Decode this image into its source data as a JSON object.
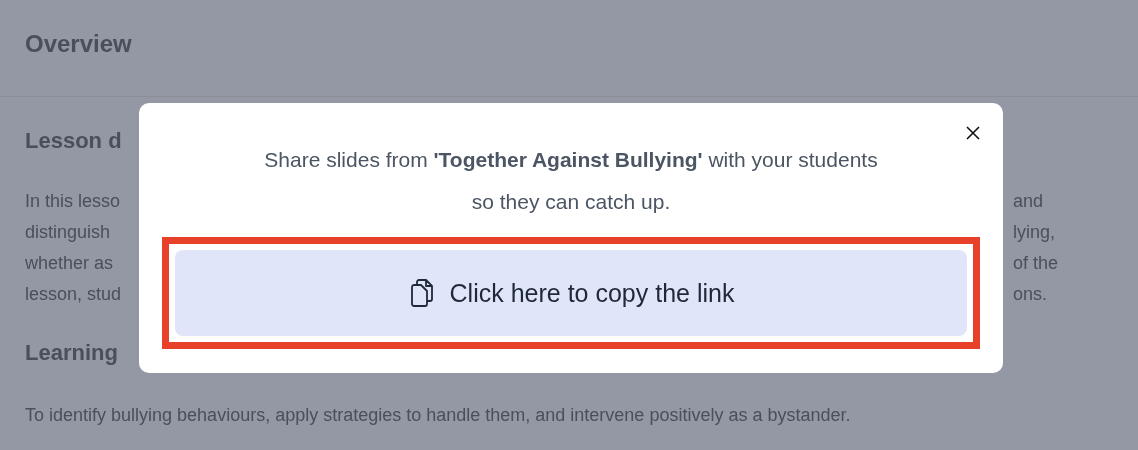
{
  "page": {
    "title": "Overview",
    "sections": [
      {
        "heading": "Lesson d",
        "lines": [
          {
            "left": "In this lesso",
            "right": "and"
          },
          {
            "left": "distinguish",
            "right": "lying,"
          },
          {
            "left": "whether as",
            "right": "of the"
          },
          {
            "left": "lesson, stud",
            "right": "ons."
          }
        ]
      },
      {
        "heading": "Learning",
        "lines": [
          {
            "left": "To identify bullying behaviours, apply strategies to handle them, and intervene positively as a bystander."
          }
        ]
      }
    ]
  },
  "dialog": {
    "message": "Share slides from **'Together Against Bullying'** with your students so they can catch up.",
    "button": "Click here to copy the link",
    "highlighted": true
  }
}
